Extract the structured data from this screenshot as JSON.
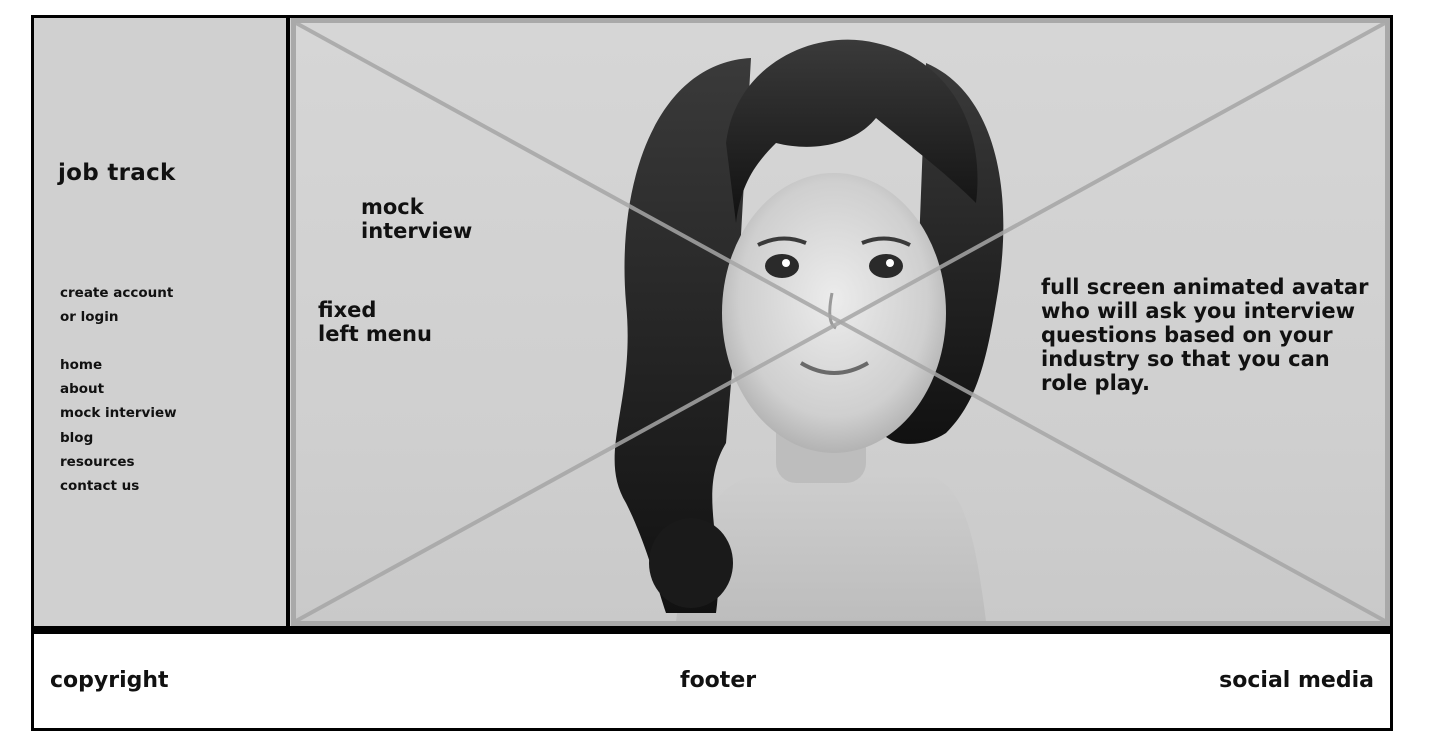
{
  "sidebar": {
    "brand": "job track",
    "account": {
      "line1": "create account",
      "line2": "or login"
    },
    "nav": [
      "home",
      "about",
      "mock interview",
      "blog",
      "resources",
      "contact us"
    ]
  },
  "hero": {
    "notes": {
      "mock_line1": "mock",
      "mock_line2": "interview",
      "fixed_line1": "fixed",
      "fixed_line2": "left menu",
      "desc_lines": [
        "full screen animated avatar",
        "who will ask you interview",
        "questions based on your",
        "industry so that you can",
        "role play."
      ]
    }
  },
  "footer": {
    "left": "copyright",
    "center": "footer",
    "right": "social media"
  },
  "colors": {
    "sidebar_bg": "#d0d0d0",
    "hero_bg": "#d3d3d3",
    "border": "#000000",
    "placeholder_cross": "#a6a6a6"
  }
}
